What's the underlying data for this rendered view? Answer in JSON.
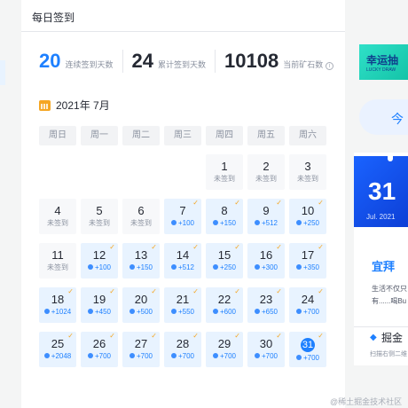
{
  "page": {
    "title": "每日签到"
  },
  "stats": [
    {
      "num": "20",
      "label": "连续签到天数"
    },
    {
      "num": "24",
      "label": "累计签到天数"
    },
    {
      "num": "10108",
      "label": "当前矿石数",
      "info_icon": "i"
    }
  ],
  "calendar": {
    "month_label": "2021年 7月",
    "weekdays": [
      "周日",
      "周一",
      "周二",
      "周三",
      "周四",
      "周五",
      "周六"
    ],
    "leading_blanks": 4,
    "days": [
      {
        "d": "1",
        "status": "未签到",
        "signed": false
      },
      {
        "d": "2",
        "status": "未签到",
        "signed": false
      },
      {
        "d": "3",
        "status": "未签到",
        "signed": false
      },
      {
        "d": "4",
        "status": "未签到",
        "signed": false
      },
      {
        "d": "5",
        "status": "未签到",
        "signed": false
      },
      {
        "d": "6",
        "status": "未签到",
        "signed": false
      },
      {
        "d": "7",
        "status": "+100",
        "signed": true
      },
      {
        "d": "8",
        "status": "+150",
        "signed": true
      },
      {
        "d": "9",
        "status": "+512",
        "signed": true
      },
      {
        "d": "10",
        "status": "+250",
        "signed": true
      },
      {
        "d": "11",
        "status": "未签到",
        "signed": false
      },
      {
        "d": "12",
        "status": "+100",
        "signed": true
      },
      {
        "d": "13",
        "status": "+150",
        "signed": true
      },
      {
        "d": "14",
        "status": "+512",
        "signed": true
      },
      {
        "d": "15",
        "status": "+250",
        "signed": true
      },
      {
        "d": "16",
        "status": "+300",
        "signed": true
      },
      {
        "d": "17",
        "status": "+350",
        "signed": true
      },
      {
        "d": "18",
        "status": "+1024",
        "signed": true
      },
      {
        "d": "19",
        "status": "+450",
        "signed": true
      },
      {
        "d": "20",
        "status": "+500",
        "signed": true
      },
      {
        "d": "21",
        "status": "+550",
        "signed": true
      },
      {
        "d": "22",
        "status": "+600",
        "signed": true
      },
      {
        "d": "23",
        "status": "+650",
        "signed": true
      },
      {
        "d": "24",
        "status": "+700",
        "signed": true
      },
      {
        "d": "25",
        "status": "+2048",
        "signed": true
      },
      {
        "d": "26",
        "status": "+700",
        "signed": true
      },
      {
        "d": "27",
        "status": "+700",
        "signed": true
      },
      {
        "d": "28",
        "status": "+700",
        "signed": true
      },
      {
        "d": "29",
        "status": "+700",
        "signed": true
      },
      {
        "d": "30",
        "status": "+700",
        "signed": true
      },
      {
        "d": "31",
        "status": "+700",
        "signed": true,
        "today": true
      }
    ]
  },
  "right_panel": {
    "banner_title": "幸运抽",
    "banner_sub": "LUCKY DRAW",
    "today_button": "今",
    "promo_big": "31",
    "promo_date": "Jul. 2021",
    "promo_title": "宜拜",
    "promo_line1": "生活不仅只",
    "promo_line2": "有......喝Bu",
    "brand_name": "掘金",
    "brand_sub": "扫描右侧二维"
  },
  "watermark": "@稀土掘金技术社区",
  "colors": {
    "accent": "#1e80ff",
    "signed_bg": "#e8f3ff",
    "check": "#f5a623"
  }
}
